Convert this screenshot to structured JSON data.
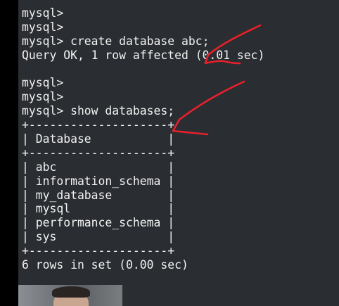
{
  "terminal": {
    "lines": [
      "mysql>",
      "mysql>",
      "mysql> create database abc;",
      "Query OK, 1 row affected (0.01 sec)",
      "",
      "mysql>",
      "mysql>",
      "mysql> show databases;",
      "+--------------------+",
      "| Database           |",
      "+--------------------+",
      "| abc                |",
      "| information_schema |",
      "| my_database        |",
      "| mysql              |",
      "| performance_schema |",
      "| sys                |",
      "+--------------------+",
      "6 rows in set (0.00 sec)"
    ]
  },
  "colors": {
    "terminal_background": "#2a2d31",
    "terminal_text": "#f2f2f2",
    "annotation_stroke": "#e8202a"
  }
}
